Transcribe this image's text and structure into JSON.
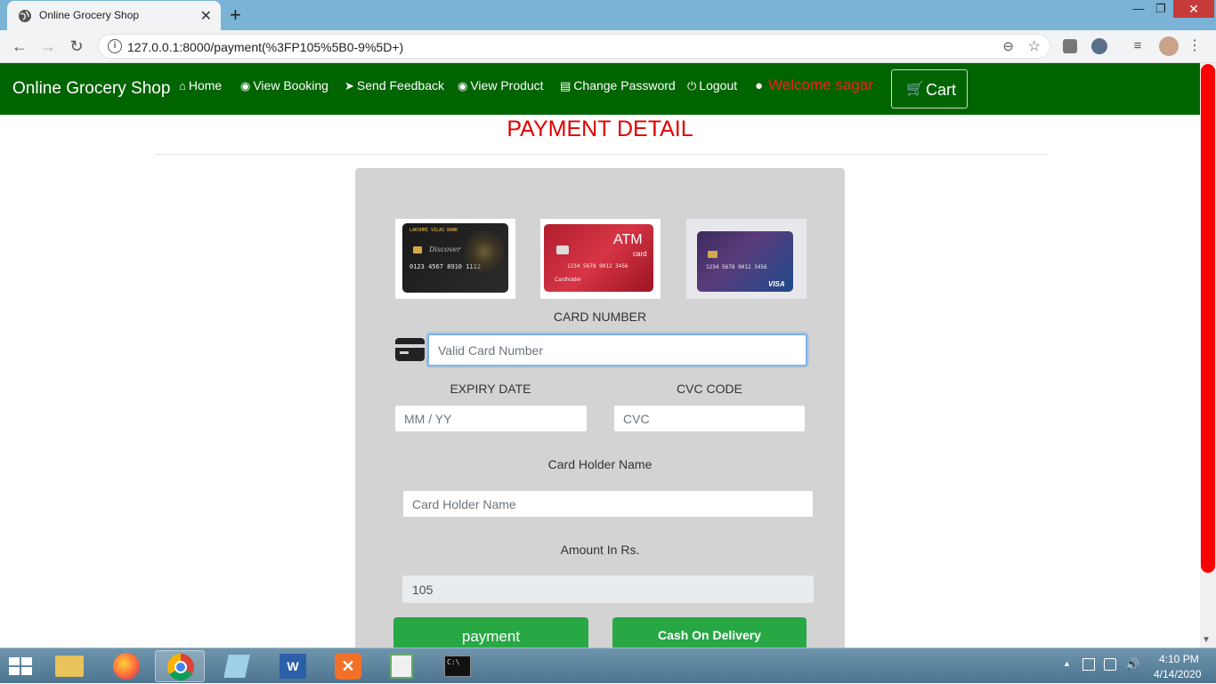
{
  "browser": {
    "tab_title": "Online Grocery Shop",
    "url": "127.0.0.1:8000/payment(%3FP105%5B0-9%5D+)"
  },
  "site": {
    "brand": "Online Grocery Shop",
    "nav": {
      "home": "Home",
      "view_booking": "View Booking",
      "send_feedback": "Send Feedback",
      "view_product": "View Product",
      "change_password": "Change Password",
      "logout": "Logout",
      "welcome": "Welcome sagar",
      "cart": "Cart"
    }
  },
  "page": {
    "title": "PAYMENT DETAIL",
    "cards": {
      "card1_bank": "LAKSHMI VILAS BANK",
      "card1_brand": "Discover",
      "card1_number": "0123 4567 8910 1112",
      "card2_title": "ATM",
      "card2_sub": "card",
      "card2_number": "1234 5678 9012 3456",
      "card2_holder": "Cardholder",
      "card3_number": "1234 5678 9012 3456",
      "card3_brand": "VISA"
    },
    "labels": {
      "card_number": "CARD NUMBER",
      "expiry": "EXPIRY DATE",
      "cvc": "CVC CODE",
      "holder": "Card Holder Name",
      "amount": "Amount In Rs."
    },
    "placeholders": {
      "card_number": "Valid Card Number",
      "expiry": "MM / YY",
      "cvc": "CVC",
      "holder": "Card Holder Name"
    },
    "amount_value": "105",
    "buttons": {
      "payment": "payment",
      "cod": "Cash On Delivery"
    }
  },
  "taskbar": {
    "time": "4:10 PM",
    "date": "4/14/2020"
  },
  "colors": {
    "navbar": "#006400",
    "title_red": "#e00000",
    "welcome_red": "#ff1a1a",
    "button_green": "#28a745",
    "panel_gray": "#d3d3d3"
  }
}
